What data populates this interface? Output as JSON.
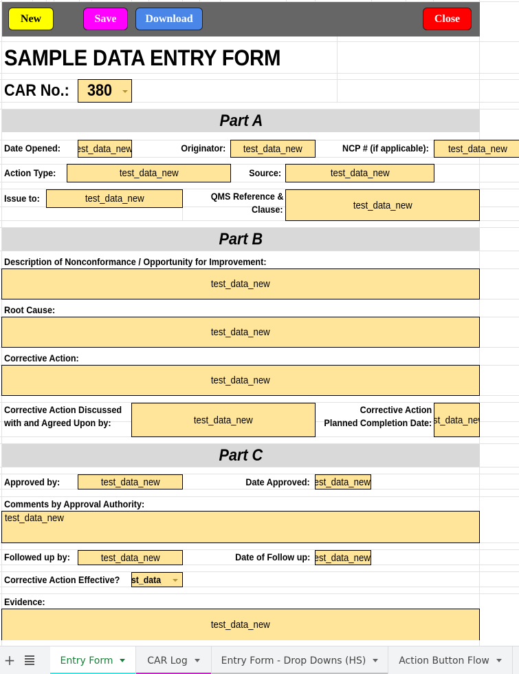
{
  "toolbar": {
    "new_label": "New",
    "save_label": "Save",
    "download_label": "Download",
    "close_label": "Close",
    "colors": {
      "new": "#ffff00",
      "save": "#ff00ff",
      "download": "#4a86e8",
      "close": "#ff0000",
      "background": "#666666"
    }
  },
  "form": {
    "title": "SAMPLE DATA ENTRY FORM",
    "car_no_label": "CAR No.:",
    "car_no_value": "380",
    "field_color": "#ffe599",
    "part_a": {
      "heading": "Part A",
      "date_opened_label": "Date Opened:",
      "date_opened_value": "test_data_new",
      "originator_label": "Originator:",
      "originator_value": "test_data_new",
      "ncp_label": "NCP # (if applicable):",
      "ncp_value": "test_data_new",
      "action_type_label": "Action Type:",
      "action_type_value": "test_data_new",
      "source_label": "Source:",
      "source_value": "test_data_new",
      "issue_to_label": "Issue to:",
      "issue_to_value": "test_data_new",
      "qms_label_line1": "QMS Reference &",
      "qms_label_line2": "Clause:",
      "qms_value": "test_data_new"
    },
    "part_b": {
      "heading": "Part B",
      "description_label": "Description of Nonconformance / Opportunity for Improvement:",
      "description_value": "test_data_new",
      "root_cause_label": "Root Cause:",
      "root_cause_value": "test_data_new",
      "corrective_action_label": "Corrective Action:",
      "corrective_action_value": "test_data_new",
      "discussed_label_line1": "Corrective Action Discussed",
      "discussed_label_line2": "with and Agreed Upon by:",
      "discussed_value": "test_data_new",
      "planned_label_line1": "Corrective Action",
      "planned_label_line2": "Planned Completion Date:",
      "planned_value": "test_data_new"
    },
    "part_c": {
      "heading": "Part C",
      "approved_by_label": "Approved by:",
      "approved_by_value": "test_data_new",
      "date_approved_label": "Date Approved:",
      "date_approved_value": "test_data_new",
      "comments_label": "Comments by Approval Authority:",
      "comments_value": "test_data_new",
      "followed_up_label": "Followed up by:",
      "followed_up_value": "test_data_new",
      "date_follow_up_label": "Date of Follow up:",
      "date_follow_up_value": "test_data_new",
      "effective_label": "Corrective Action Effective?",
      "effective_value": "test_data_new",
      "evidence_label": "Evidence:",
      "evidence_value": "test_data_new"
    }
  },
  "sheet_tabs": {
    "add_icon": "plus-icon",
    "list_icon": "all-sheets-icon",
    "tabs": [
      {
        "label": "Entry Form",
        "active": true,
        "color": "#00ffff"
      },
      {
        "label": "CAR Log",
        "active": false,
        "color": "#ff00ff"
      },
      {
        "label": "Entry Form - Drop Downs (HS)",
        "active": false,
        "color": "#c0c0c0"
      },
      {
        "label": "Action Button Flow",
        "active": false,
        "color": ""
      }
    ]
  }
}
